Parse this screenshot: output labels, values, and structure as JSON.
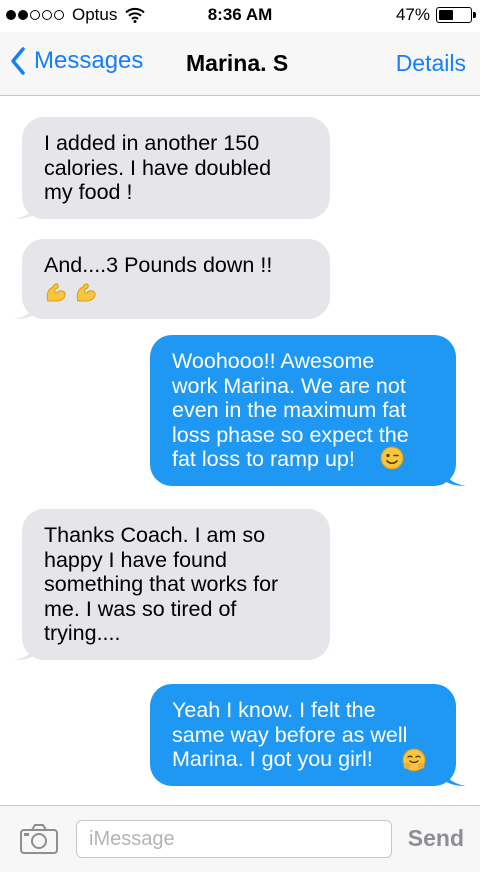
{
  "status_bar": {
    "signal_strength": 2,
    "signal_total": 5,
    "carrier": "Optus",
    "time": "8:36 AM",
    "battery_percent_label": "47%",
    "battery_level": 0.47
  },
  "nav": {
    "back_label": "Messages",
    "contact_name": "Marina. S",
    "details_label": "Details"
  },
  "messages": [
    {
      "direction": "incoming",
      "text": "I added in another 150\ncalories. I have doubled\nmy food !",
      "emoji": ""
    },
    {
      "direction": "incoming",
      "text": "And....3 Pounds down !!",
      "emoji": "flexed-biceps flexed-biceps"
    },
    {
      "direction": "outgoing",
      "text": "Woohooo!! Awesome\nwork Marina. We are not\neven in the maximum fat\nloss phase so expect the\nfat loss to ramp up!",
      "emoji": "winking-face"
    },
    {
      "direction": "incoming",
      "text": "Thanks Coach. I am so\nhappy I have found\nsomething that works for\nme. I was so tired of\ntrying....",
      "emoji": ""
    },
    {
      "direction": "outgoing",
      "text": "Yeah I know. I felt the\nsame way before as well\nMarina. I got you girl!",
      "emoji": "hugging-face"
    }
  ],
  "composer": {
    "placeholder": "iMessage",
    "value": "",
    "send_label": "Send",
    "camera_icon": "camera-icon"
  },
  "colors": {
    "accent": "#147efb",
    "outgoing_bubble": "#1e98f3",
    "incoming_bubble": "#e5e5ea",
    "send_disabled": "#8e8e93"
  }
}
